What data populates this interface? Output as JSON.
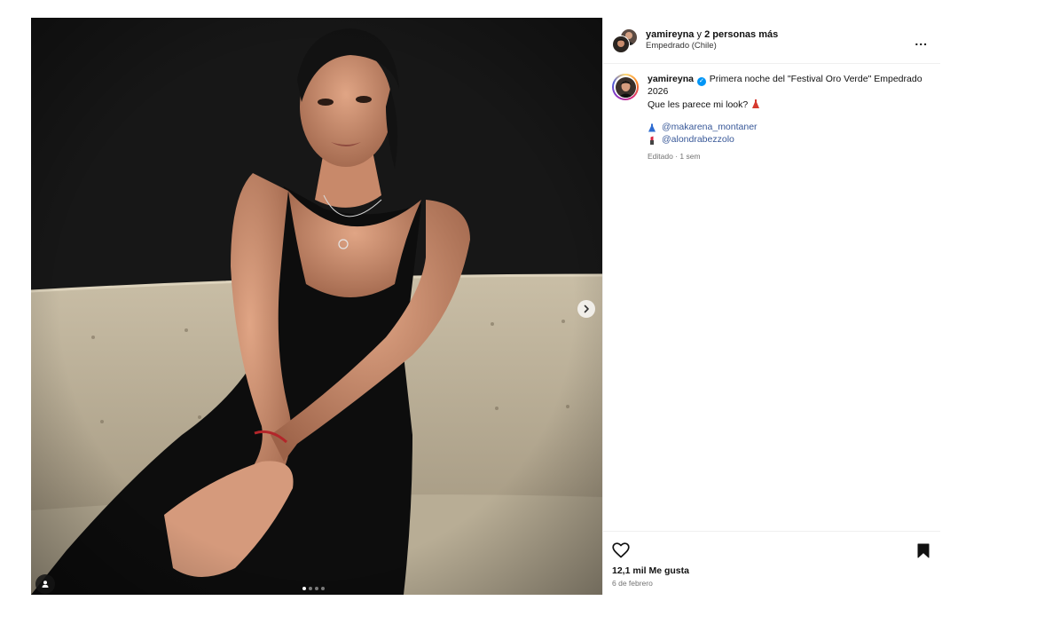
{
  "header": {
    "owner_username": "yamireyna",
    "collab_connector": " y ",
    "collab_others": "2 personas más",
    "location": "Empedrado (Chile)",
    "more_icon": "more-horizontal-icon",
    "more_label": "..."
  },
  "caption": {
    "username": "yamireyna",
    "verified_icon": "verified-badge-icon",
    "text": "Primera noche del \"Festival Oro Verde\" Empedrado 2026",
    "line2": "Que les parece mi look?",
    "line2_emoji": "dress-emoji",
    "mentions": [
      {
        "emoji": "dress-emoji",
        "handle": "@makarena_montaner"
      },
      {
        "emoji": "lipstick-emoji",
        "handle": "@alondrabezzolo"
      }
    ],
    "meta": "Editado · 1 sem"
  },
  "media": {
    "carousel_count": 4,
    "carousel_active": 1,
    "next_icon": "chevron-right-icon",
    "tag_icon": "user-tag-icon"
  },
  "actions": {
    "like_icon": "heart-icon",
    "save_icon": "bookmark-icon",
    "likes": "12,1 mil Me gusta",
    "date": "6 de febrero"
  },
  "colors": {
    "link": "#385898",
    "verified": "#0095f6",
    "muted": "#737373",
    "divider": "#efefef"
  }
}
